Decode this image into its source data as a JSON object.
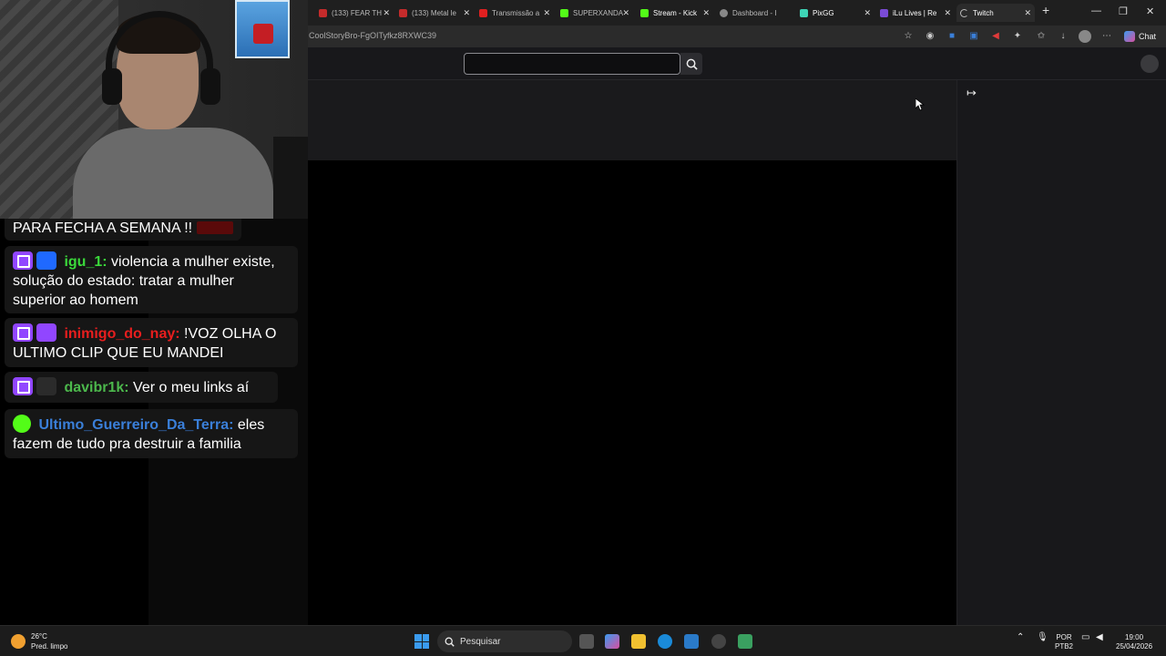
{
  "tabs": [
    {
      "label": "(133) FEAR TH",
      "fav": "#c42b2b"
    },
    {
      "label": "(133) Metal le",
      "fav": "#c42b2b"
    },
    {
      "label": "Transmissão a",
      "fav": "#e02020"
    },
    {
      "label": "SUPERXANDA",
      "fav": "#53fc18"
    },
    {
      "label": "Stream - Kick",
      "fav": "#53fc18"
    },
    {
      "label": "Dashboard - I",
      "fav": "#888888"
    },
    {
      "label": "PixGG",
      "fav": "#3ed4b6"
    },
    {
      "label": "iLu Lives | Re",
      "fav": "#7a4bd6"
    },
    {
      "label": "Twitch",
      "fav": "#bbbbbb"
    }
  ],
  "window": {
    "new_tab": "+",
    "minimize": "—",
    "restore": "❐",
    "close": "✕"
  },
  "address": {
    "url": "CoolStoryBro-FgOITyfkz8RXWC39"
  },
  "toolbar": {
    "chat_label": "Chat",
    "more": "⋯"
  },
  "site": {
    "search_placeholder": "",
    "collapse_glyph": "↦"
  },
  "chat": [
    {
      "user": "",
      "color": "#ffffff",
      "badges": [],
      "text": "PARA FECHA A SEMANA !!"
    },
    {
      "user": "igu_1:",
      "color": "#3bd93b",
      "badges": [
        "twitch",
        "crown"
      ],
      "text": " violencia a mulher existe, solução do estado: tratar a mulher superior ao homem"
    },
    {
      "user": "inimigo_do_nay:",
      "color": "#e81e1e",
      "badges": [
        "twitch",
        "star"
      ],
      "text": " !VOZ OLHA O ULTIMO CLIP QUE EU MANDEI"
    },
    {
      "user": "davibr1k:",
      "color": "#4cb84c",
      "badges": [
        "twitch",
        "mute"
      ],
      "text": " Ver o meu links aí"
    },
    {
      "user": "Ultimo_Guerreiro_Da_Terra:",
      "color": "#3a7fd9",
      "badges": [
        "kick"
      ],
      "text": " eles fazem de tudo pra destruir a familia"
    }
  ],
  "taskbar": {
    "temp": "26°C",
    "weather": "Pred. limpo",
    "search": "Pesquisar",
    "lang1": "POR",
    "lang2": "PTB2",
    "time": "19:00",
    "date": "25/04/2026"
  }
}
